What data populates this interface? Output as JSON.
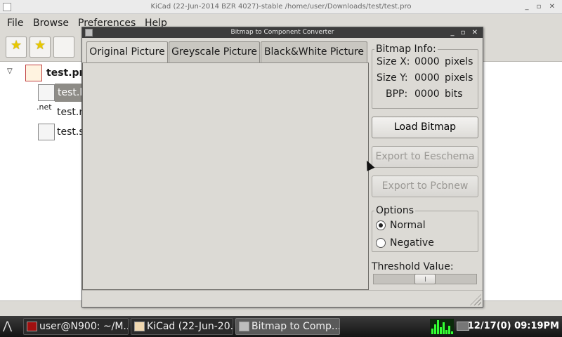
{
  "main_window": {
    "title": "KiCad (22-Jun-2014 BZR 4027)-stable /home/user/Downloads/test/test.pro",
    "controls": "_ ▫ ✕",
    "menu": [
      "File",
      "Browse",
      "Preferences",
      "Help"
    ],
    "tree": {
      "root": "test.pro",
      "items": [
        "test.k",
        "test.n",
        "test.s"
      ],
      "net_icon_label": ".net"
    }
  },
  "dialog": {
    "title": "Bitmap to Component Converter",
    "controls": "_ ▫ ✕",
    "tabs": [
      "Original Picture",
      "Greyscale Picture",
      "Black&White Picture"
    ],
    "active_tab": 0,
    "bitmap_info": {
      "heading": "Bitmap Info:",
      "rows": [
        {
          "label": "Size X:",
          "value": "0000",
          "unit": "pixels"
        },
        {
          "label": "Size Y:",
          "value": "0000",
          "unit": "pixels"
        },
        {
          "label": "BPP:",
          "value": "0000",
          "unit": "bits"
        }
      ]
    },
    "buttons": {
      "load": "Load Bitmap",
      "export_eeschema": "Export to Eeschema",
      "export_pcbnew": "Export to Pcbnew"
    },
    "options": {
      "heading": "Options",
      "normal": "Normal",
      "negative": "Negative",
      "selected": "Normal"
    },
    "threshold": {
      "label": "Threshold Value:",
      "value_fraction": 0.5
    }
  },
  "taskbar": {
    "tasks": [
      "user@N900: ~/M...",
      "KiCad (22-Jun-20...",
      "Bitmap to Comp..."
    ],
    "active_task": 2,
    "clock": "12/17(0) 09:19PM"
  }
}
